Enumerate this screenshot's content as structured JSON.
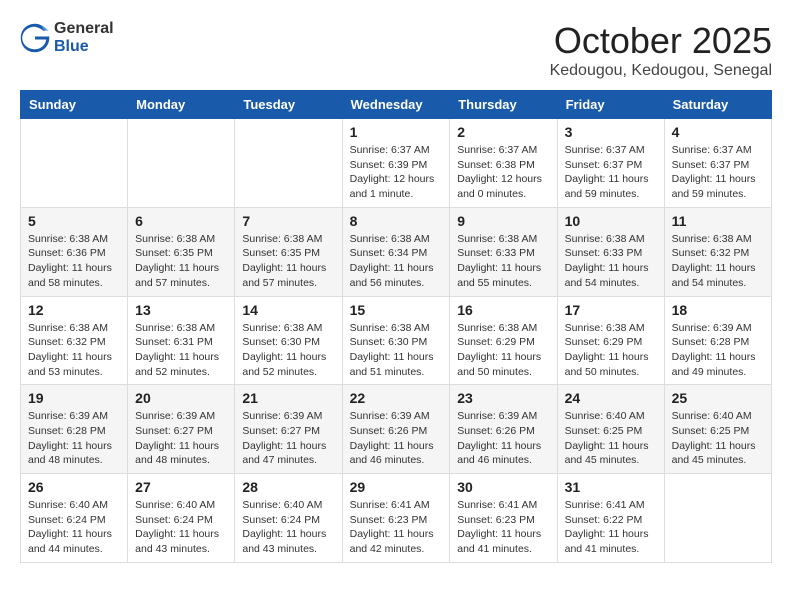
{
  "header": {
    "logo_general": "General",
    "logo_blue": "Blue",
    "month_title": "October 2025",
    "location": "Kedougou, Kedougou, Senegal"
  },
  "columns": [
    "Sunday",
    "Monday",
    "Tuesday",
    "Wednesday",
    "Thursday",
    "Friday",
    "Saturday"
  ],
  "weeks": [
    {
      "days": [
        {
          "number": "",
          "detail": ""
        },
        {
          "number": "",
          "detail": ""
        },
        {
          "number": "",
          "detail": ""
        },
        {
          "number": "1",
          "detail": "Sunrise: 6:37 AM\nSunset: 6:39 PM\nDaylight: 12 hours\nand 1 minute."
        },
        {
          "number": "2",
          "detail": "Sunrise: 6:37 AM\nSunset: 6:38 PM\nDaylight: 12 hours\nand 0 minutes."
        },
        {
          "number": "3",
          "detail": "Sunrise: 6:37 AM\nSunset: 6:37 PM\nDaylight: 11 hours\nand 59 minutes."
        },
        {
          "number": "4",
          "detail": "Sunrise: 6:37 AM\nSunset: 6:37 PM\nDaylight: 11 hours\nand 59 minutes."
        }
      ]
    },
    {
      "days": [
        {
          "number": "5",
          "detail": "Sunrise: 6:38 AM\nSunset: 6:36 PM\nDaylight: 11 hours\nand 58 minutes."
        },
        {
          "number": "6",
          "detail": "Sunrise: 6:38 AM\nSunset: 6:35 PM\nDaylight: 11 hours\nand 57 minutes."
        },
        {
          "number": "7",
          "detail": "Sunrise: 6:38 AM\nSunset: 6:35 PM\nDaylight: 11 hours\nand 57 minutes."
        },
        {
          "number": "8",
          "detail": "Sunrise: 6:38 AM\nSunset: 6:34 PM\nDaylight: 11 hours\nand 56 minutes."
        },
        {
          "number": "9",
          "detail": "Sunrise: 6:38 AM\nSunset: 6:33 PM\nDaylight: 11 hours\nand 55 minutes."
        },
        {
          "number": "10",
          "detail": "Sunrise: 6:38 AM\nSunset: 6:33 PM\nDaylight: 11 hours\nand 54 minutes."
        },
        {
          "number": "11",
          "detail": "Sunrise: 6:38 AM\nSunset: 6:32 PM\nDaylight: 11 hours\nand 54 minutes."
        }
      ]
    },
    {
      "days": [
        {
          "number": "12",
          "detail": "Sunrise: 6:38 AM\nSunset: 6:32 PM\nDaylight: 11 hours\nand 53 minutes."
        },
        {
          "number": "13",
          "detail": "Sunrise: 6:38 AM\nSunset: 6:31 PM\nDaylight: 11 hours\nand 52 minutes."
        },
        {
          "number": "14",
          "detail": "Sunrise: 6:38 AM\nSunset: 6:30 PM\nDaylight: 11 hours\nand 52 minutes."
        },
        {
          "number": "15",
          "detail": "Sunrise: 6:38 AM\nSunset: 6:30 PM\nDaylight: 11 hours\nand 51 minutes."
        },
        {
          "number": "16",
          "detail": "Sunrise: 6:38 AM\nSunset: 6:29 PM\nDaylight: 11 hours\nand 50 minutes."
        },
        {
          "number": "17",
          "detail": "Sunrise: 6:38 AM\nSunset: 6:29 PM\nDaylight: 11 hours\nand 50 minutes."
        },
        {
          "number": "18",
          "detail": "Sunrise: 6:39 AM\nSunset: 6:28 PM\nDaylight: 11 hours\nand 49 minutes."
        }
      ]
    },
    {
      "days": [
        {
          "number": "19",
          "detail": "Sunrise: 6:39 AM\nSunset: 6:28 PM\nDaylight: 11 hours\nand 48 minutes."
        },
        {
          "number": "20",
          "detail": "Sunrise: 6:39 AM\nSunset: 6:27 PM\nDaylight: 11 hours\nand 48 minutes."
        },
        {
          "number": "21",
          "detail": "Sunrise: 6:39 AM\nSunset: 6:27 PM\nDaylight: 11 hours\nand 47 minutes."
        },
        {
          "number": "22",
          "detail": "Sunrise: 6:39 AM\nSunset: 6:26 PM\nDaylight: 11 hours\nand 46 minutes."
        },
        {
          "number": "23",
          "detail": "Sunrise: 6:39 AM\nSunset: 6:26 PM\nDaylight: 11 hours\nand 46 minutes."
        },
        {
          "number": "24",
          "detail": "Sunrise: 6:40 AM\nSunset: 6:25 PM\nDaylight: 11 hours\nand 45 minutes."
        },
        {
          "number": "25",
          "detail": "Sunrise: 6:40 AM\nSunset: 6:25 PM\nDaylight: 11 hours\nand 45 minutes."
        }
      ]
    },
    {
      "days": [
        {
          "number": "26",
          "detail": "Sunrise: 6:40 AM\nSunset: 6:24 PM\nDaylight: 11 hours\nand 44 minutes."
        },
        {
          "number": "27",
          "detail": "Sunrise: 6:40 AM\nSunset: 6:24 PM\nDaylight: 11 hours\nand 43 minutes."
        },
        {
          "number": "28",
          "detail": "Sunrise: 6:40 AM\nSunset: 6:24 PM\nDaylight: 11 hours\nand 43 minutes."
        },
        {
          "number": "29",
          "detail": "Sunrise: 6:41 AM\nSunset: 6:23 PM\nDaylight: 11 hours\nand 42 minutes."
        },
        {
          "number": "30",
          "detail": "Sunrise: 6:41 AM\nSunset: 6:23 PM\nDaylight: 11 hours\nand 41 minutes."
        },
        {
          "number": "31",
          "detail": "Sunrise: 6:41 AM\nSunset: 6:22 PM\nDaylight: 11 hours\nand 41 minutes."
        },
        {
          "number": "",
          "detail": ""
        }
      ]
    }
  ]
}
